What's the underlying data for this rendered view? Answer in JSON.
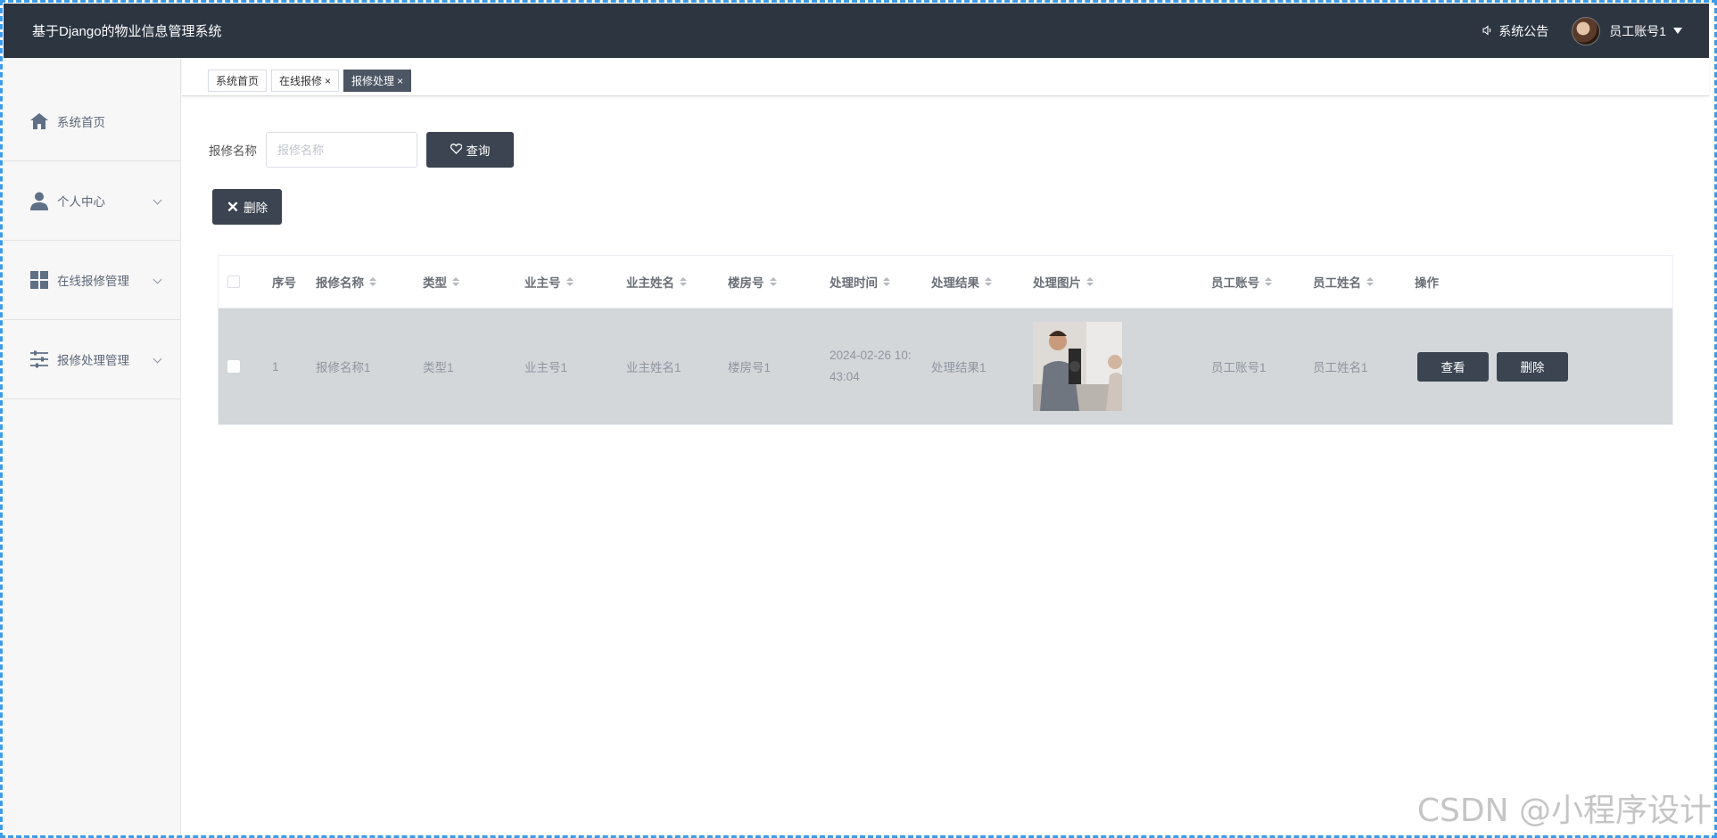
{
  "header": {
    "title": "基于Django的物业信息管理系统",
    "notice_label": "系统公告",
    "user_name": "员工账号1"
  },
  "sidebar": {
    "items": [
      {
        "label": "系统首页",
        "icon": "home-icon"
      },
      {
        "label": "个人中心",
        "icon": "user-icon"
      },
      {
        "label": "在线报修管理",
        "icon": "grid-icon"
      },
      {
        "label": "报修处理管理",
        "icon": "sliders-icon"
      }
    ]
  },
  "tabs": [
    {
      "label": "系统首页",
      "closable": false,
      "active": false
    },
    {
      "label": "在线报修",
      "closable": true,
      "active": false
    },
    {
      "label": "报修处理",
      "closable": true,
      "active": true
    }
  ],
  "search": {
    "label": "报修名称",
    "placeholder": "报修名称",
    "value": "",
    "button_label": "查询"
  },
  "actions": {
    "delete_label": "删除"
  },
  "table": {
    "columns": [
      "序号",
      "报修名称",
      "类型",
      "业主号",
      "业主姓名",
      "楼房号",
      "处理时间",
      "处理结果",
      "处理图片",
      "员工账号",
      "员工姓名",
      "操作"
    ],
    "rows": [
      {
        "index": "1",
        "repair_name": "报修名称1",
        "type": "类型1",
        "owner_no": "业主号1",
        "owner_name": "业主姓名1",
        "building_no": "楼房号1",
        "time": "2024-02-26 10:43:04",
        "result": "处理结果1",
        "staff_account": "员工账号1",
        "staff_name": "员工姓名1",
        "view_label": "查看",
        "delete_label": "删除"
      }
    ]
  },
  "watermark": "CSDN @小程序设计",
  "colors": {
    "header_bg": "#2d3541",
    "button_dark": "#3b4450",
    "row_selected": "#d4d7da",
    "frame_dash": "#3d9be9"
  }
}
